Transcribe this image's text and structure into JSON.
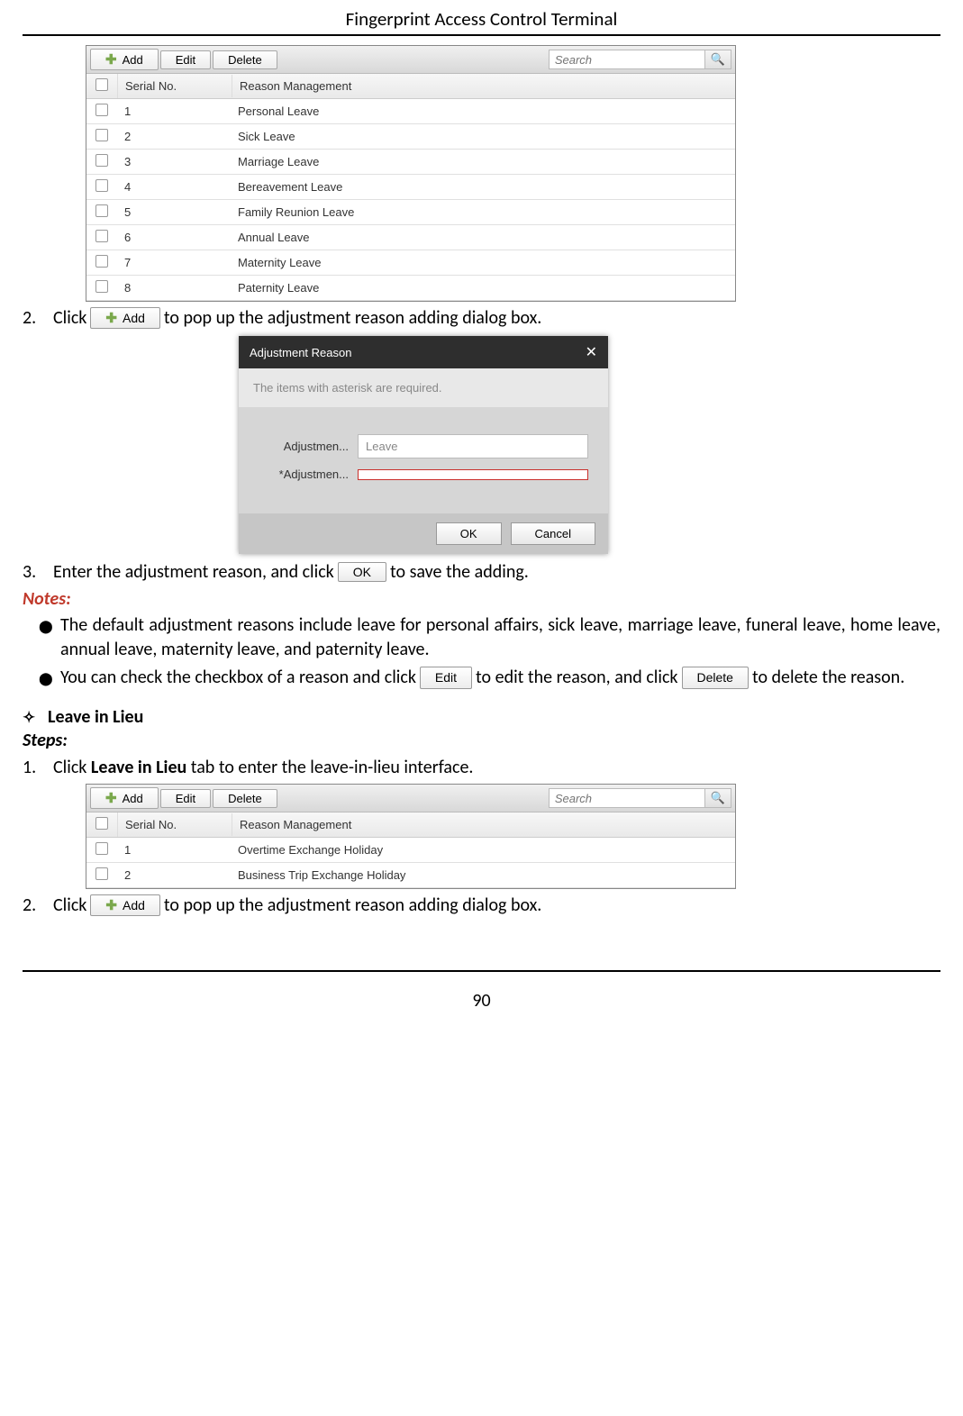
{
  "header_title": "Fingerprint Access Control Terminal",
  "page_number": "90",
  "panel1": {
    "buttons": {
      "add": "Add",
      "edit": "Edit",
      "delete": "Delete"
    },
    "search_placeholder": "Search",
    "columns": {
      "serial": "Serial No.",
      "reason": "Reason Management"
    },
    "rows": [
      {
        "sn": "1",
        "reason": "Personal Leave"
      },
      {
        "sn": "2",
        "reason": "Sick Leave"
      },
      {
        "sn": "3",
        "reason": "Marriage Leave"
      },
      {
        "sn": "4",
        "reason": "Bereavement Leave"
      },
      {
        "sn": "5",
        "reason": "Family Reunion Leave"
      },
      {
        "sn": "6",
        "reason": "Annual Leave"
      },
      {
        "sn": "7",
        "reason": "Maternity Leave"
      },
      {
        "sn": "8",
        "reason": "Paternity Leave"
      }
    ]
  },
  "step2a": {
    "num": "2.",
    "pre": "Click",
    "btn": "Add",
    "post": "to pop up the adjustment reason adding dialog box."
  },
  "dialog": {
    "title": "Adjustment Reason",
    "hint": "The items with asterisk are required.",
    "label_major": "Adjustmen...",
    "input_major_value": "Leave",
    "label_minor": "*Adjustmen...",
    "ok": "OK",
    "cancel": "Cancel"
  },
  "step3": {
    "num": "3.",
    "pre": "Enter the adjustment reason, and click",
    "btn": "OK",
    "post": "to save the adding."
  },
  "notes_label": "Notes:",
  "note1": "The default adjustment reasons include leave for personal affairs, sick leave, marriage leave, funeral leave, home leave, annual leave, maternity leave, and paternity leave.",
  "note2": {
    "pre": "You  can  check  the  checkbox  of  a  reason  and  click",
    "btn_edit": "Edit",
    "mid": "to  edit  the  reason,  and  click",
    "btn_delete": "Delete",
    "post": "to delete the reason."
  },
  "section_lil": "Leave in Lieu",
  "steps_label": "Steps:",
  "step1b": {
    "num": "1.",
    "pre": "Click ",
    "bold": "Leave in Lieu",
    "post": " tab to enter the leave-in-lieu interface."
  },
  "panel2": {
    "buttons": {
      "add": "Add",
      "edit": "Edit",
      "delete": "Delete"
    },
    "search_placeholder": "Search",
    "columns": {
      "serial": "Serial No.",
      "reason": "Reason Management"
    },
    "rows": [
      {
        "sn": "1",
        "reason": "Overtime Exchange Holiday"
      },
      {
        "sn": "2",
        "reason": "Business Trip Exchange Holiday"
      }
    ]
  },
  "step2b": {
    "num": "2.",
    "pre": "Click",
    "btn": "Add",
    "post": "to pop up the adjustment reason adding dialog box."
  }
}
